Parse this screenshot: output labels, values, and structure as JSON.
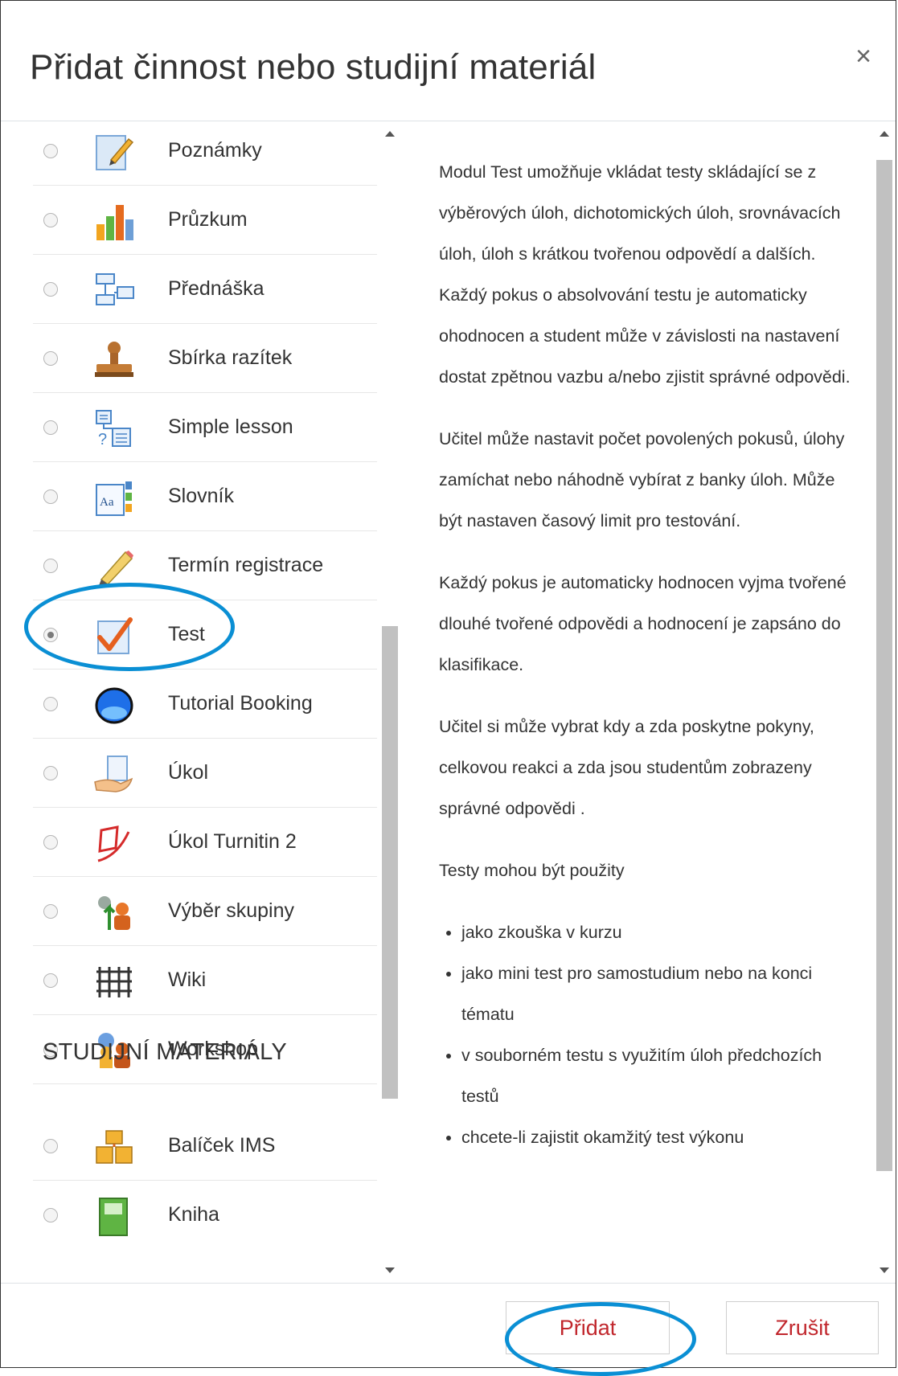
{
  "dialog": {
    "title": "Přidat činnost nebo studijní materiál",
    "close_symbol": "×"
  },
  "activities": [
    {
      "label": "Poznámky",
      "icon": "notes-icon",
      "selected": false
    },
    {
      "label": "Průzkum",
      "icon": "survey-chart-icon",
      "selected": false
    },
    {
      "label": "Přednáška",
      "icon": "lesson-flow-icon",
      "selected": false
    },
    {
      "label": "Sbírka razítek",
      "icon": "stamp-icon",
      "selected": false
    },
    {
      "label": "Simple lesson",
      "icon": "simple-lesson-icon",
      "selected": false
    },
    {
      "label": "Slovník",
      "icon": "glossary-icon",
      "selected": false
    },
    {
      "label": "Termín registrace",
      "icon": "pencil-icon",
      "selected": false
    },
    {
      "label": "Test",
      "icon": "quiz-check-icon",
      "selected": true
    },
    {
      "label": "Tutorial Booking",
      "icon": "globe-icon",
      "selected": false
    },
    {
      "label": "Úkol",
      "icon": "assignment-hand-icon",
      "selected": false
    },
    {
      "label": "Úkol Turnitin 2",
      "icon": "turnitin-icon",
      "selected": false
    },
    {
      "label": "Výběr skupiny",
      "icon": "group-choice-icon",
      "selected": false
    },
    {
      "label": "Wiki",
      "icon": "wiki-icon",
      "selected": false
    },
    {
      "label": "Workshop",
      "icon": "workshop-icon",
      "selected": false
    }
  ],
  "resources_section": {
    "title": "STUDIJNÍ MATERIÁLY",
    "items": [
      {
        "label": "Balíček IMS",
        "icon": "ims-package-icon",
        "selected": false
      },
      {
        "label": "Kniha",
        "icon": "book-icon",
        "selected": false
      }
    ]
  },
  "description": {
    "paragraphs": [
      "Modul Test umožňuje vkládat testy skládající se z výběrových úloh, dichotomických úloh, srovnávacích úloh, úloh s krátkou tvořenou odpovědí a dalších. Každý pokus o absolvování testu je automaticky ohodnocen a student může v závislosti na nastavení dostat zpětnou vazbu a/nebo zjistit správné odpovědi.",
      "Učitel může nastavit počet povolených pokusů, úlohy zamíchat nebo náhodně vybírat z banky úloh. Může být nastaven časový limit pro testování.",
      "Každý pokus je automaticky hodnocen vyjma tvořené dlouhé tvořené odpovědi a hodnocení je zapsáno do klasifikace.",
      "Učitel si může vybrat kdy a zda poskytne pokyny, celkovou reakci a zda jsou studentům zobrazeny správné odpovědi .",
      "Testy mohou být použity"
    ],
    "bullets": [
      "jako zkouška v kurzu",
      "jako mini test pro samostudium nebo na konci tématu",
      "v souborném testu s využitím úloh předchozích testů",
      "chcete-li zajistit okamžitý test výkonu"
    ]
  },
  "footer": {
    "add_label": "Přidat",
    "cancel_label": "Zrušit"
  },
  "colors": {
    "accent_red": "#c1272d",
    "annotation_blue": "#0a8fd4"
  }
}
